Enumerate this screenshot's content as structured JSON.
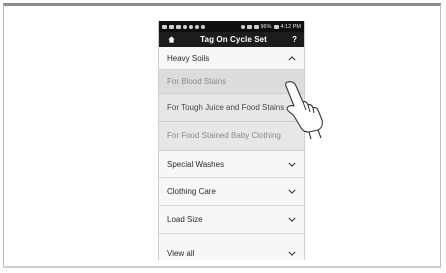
{
  "statusbar": {
    "battery": "96%",
    "time": "4:12 PM"
  },
  "appbar": {
    "title": "Tag On Cycle Set",
    "help": "?"
  },
  "menu": {
    "heavy_soils": {
      "label": "Heavy Soils",
      "expanded": true
    },
    "subitems": [
      {
        "label": "For Blood Stains"
      },
      {
        "label": "For Tough Juice and Food Stains"
      },
      {
        "label": "For Food Stained Baby Clothing"
      }
    ],
    "special_washes": {
      "label": "Special Washes"
    },
    "clothing_care": {
      "label": "Clothing Care"
    },
    "load_size": {
      "label": "Load Size"
    },
    "view_all": {
      "label": "View all"
    }
  },
  "icons": {
    "home": "home-icon",
    "chevron_up": "chevron-up-icon",
    "chevron_down": "chevron-down-icon",
    "hand": "pointing-hand-icon"
  }
}
